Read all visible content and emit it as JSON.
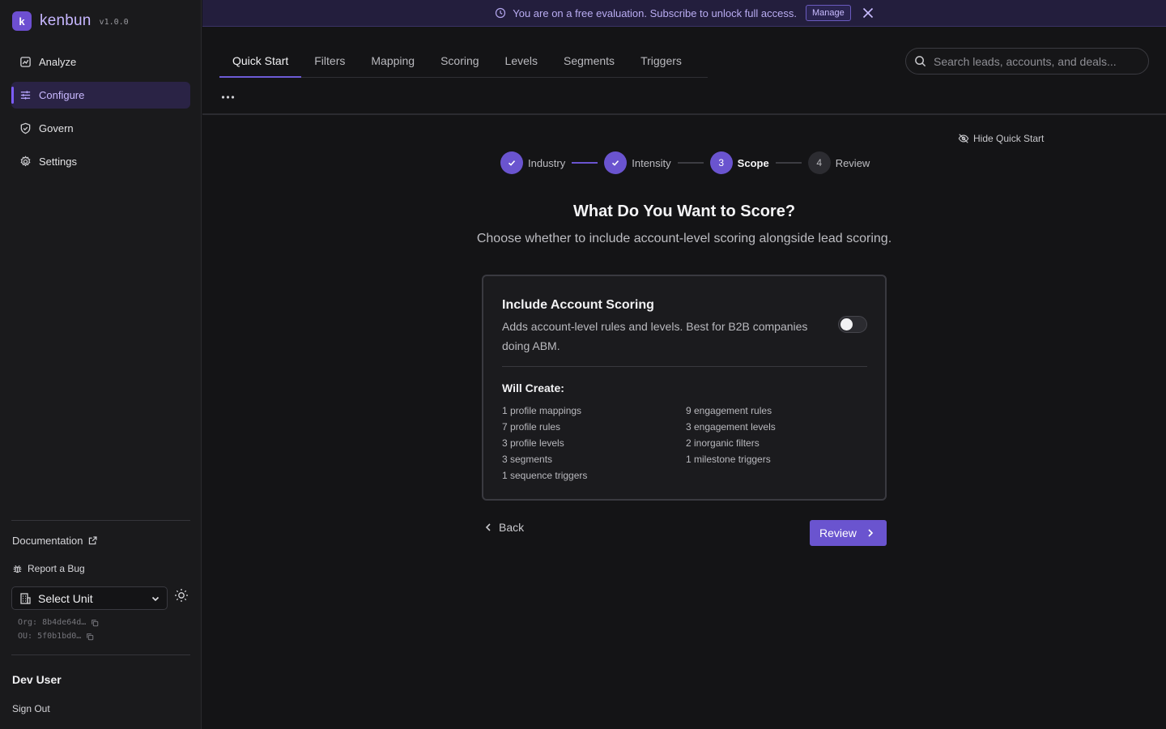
{
  "brand": {
    "name": "kenbun",
    "version": "v1.0.0",
    "logo_glyph": "k"
  },
  "sidebar": {
    "items": [
      {
        "label": "Analyze",
        "icon": "chart-icon"
      },
      {
        "label": "Configure",
        "icon": "sliders-icon",
        "active": true
      },
      {
        "label": "Govern",
        "icon": "shield-icon"
      },
      {
        "label": "Settings",
        "icon": "gear-icon"
      }
    ],
    "documentation_label": "Documentation",
    "report_bug_label": "Report a Bug",
    "unit_select_value": "Select Unit",
    "org_label": "Org:",
    "org_value": "8b4de64d…",
    "ou_label": "OU:",
    "ou_value": "5f0b1bd0…",
    "user_name": "Dev User",
    "sign_out_label": "Sign Out"
  },
  "banner": {
    "message": "You are on a free evaluation. Subscribe to unlock full access.",
    "manage_label": "Manage"
  },
  "tabs": [
    {
      "label": "Quick Start",
      "active": true
    },
    {
      "label": "Filters"
    },
    {
      "label": "Mapping"
    },
    {
      "label": "Scoring"
    },
    {
      "label": "Levels"
    },
    {
      "label": "Segments"
    },
    {
      "label": "Triggers"
    }
  ],
  "search": {
    "placeholder": "Search leads, accounts, and deals..."
  },
  "quick_start": {
    "hide_label": "Hide Quick Start",
    "steps": [
      {
        "number": "1",
        "label": "Industry",
        "status": "done"
      },
      {
        "number": "2",
        "label": "Intensity",
        "status": "done"
      },
      {
        "number": "3",
        "label": "Scope",
        "status": "current"
      },
      {
        "number": "4",
        "label": "Review",
        "status": "todo"
      }
    ],
    "title": "What Do You Want to Score?",
    "subtitle": "Choose whether to include account-level scoring alongside lead scoring.",
    "card": {
      "title": "Include Account Scoring",
      "description": "Adds account-level rules and levels. Best for B2B companies doing ABM.",
      "toggle_on": false,
      "will_create_label": "Will Create:",
      "left_items": [
        "1 profile mappings",
        "7 profile rules",
        "3 profile levels",
        "3 segments",
        "1 sequence triggers"
      ],
      "right_items": [
        "9 engagement rules",
        "3 engagement levels",
        "2 inorganic filters",
        "1 milestone triggers"
      ]
    },
    "back_label": "Back",
    "review_label": "Review"
  },
  "colors": {
    "accent": "#6a54cf",
    "banner_bg": "#231e3d",
    "sidebar_bg": "#1a1a1c",
    "page_bg": "#141416"
  }
}
